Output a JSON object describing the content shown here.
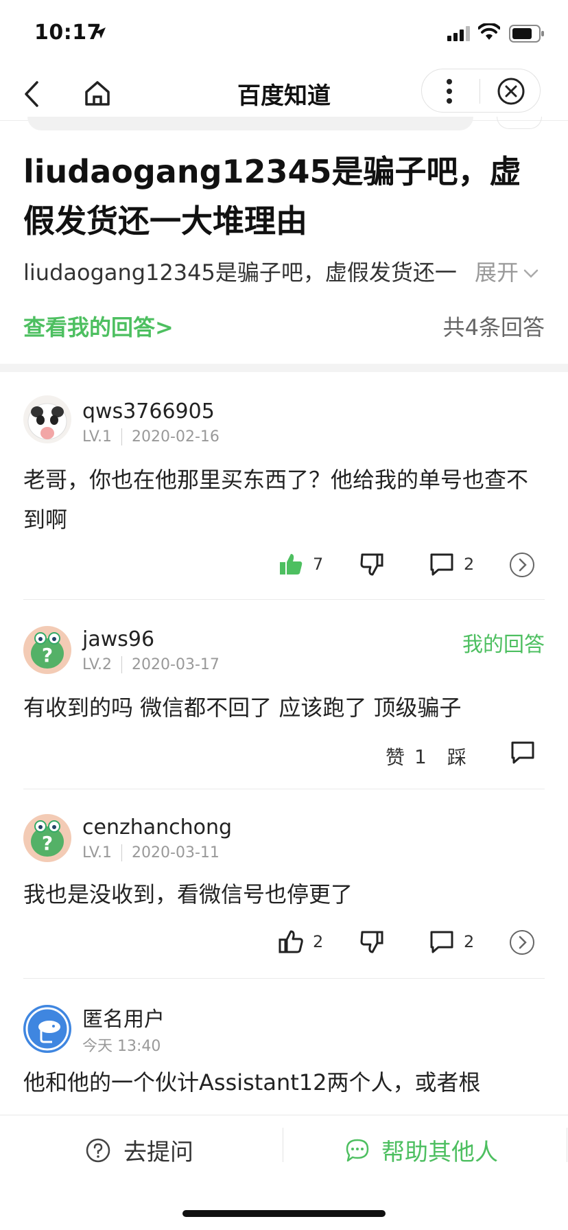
{
  "status_bar": {
    "time": "10:17"
  },
  "nav": {
    "title": "百度知道"
  },
  "question": {
    "title": "liudaogang12345是骗子吧，虚假发货还一大堆理由",
    "description": "liudaogang12345是骗子吧，虚假发货还一",
    "expand_label": "展开",
    "my_answer_link": "查看我的回答>",
    "answer_count": "共4条回答"
  },
  "answers": [
    {
      "username": "qws3766905",
      "level": "LV.1",
      "date": "2020-02-16",
      "text": "老哥，你也在他那里买东西了？他给我的单号也查不到啊",
      "likes": "7",
      "comments": "2"
    },
    {
      "username": "jaws96",
      "level": "LV.2",
      "date": "2020-03-17",
      "mine_tag": "我的回答",
      "text": "有收到的吗 微信都不回了 应该跑了 顶级骗子",
      "like_label": "赞",
      "likes": "1",
      "dislike_label": "踩"
    },
    {
      "username": "cenzhanchong",
      "level": "LV.1",
      "date": "2020-03-11",
      "text": "我也是没收到，看微信号也停更了",
      "likes": "2",
      "comments": "2"
    },
    {
      "username": "匿名用户",
      "date": "今天 13:40",
      "text": "他和他的一个伙计Assistant12两个人，或者根"
    }
  ],
  "bottom_bar": {
    "ask_label": "去提问",
    "help_label": "帮助其他人"
  },
  "colors": {
    "accent_green": "#4dbf60",
    "muted": "#999999",
    "divider": "#f3f3f3"
  }
}
